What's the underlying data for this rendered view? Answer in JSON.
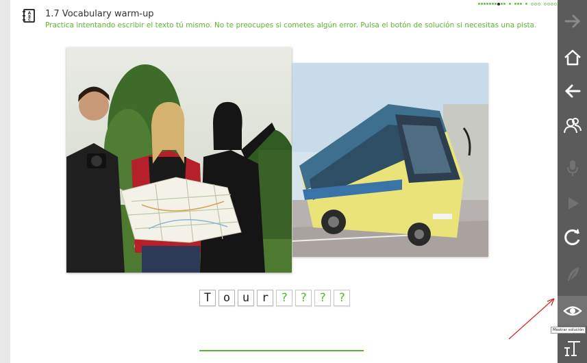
{
  "header": {
    "title": "1.7 Vocabulary warm-up",
    "instructions": "Practica intentando escribir el texto tú mismo. No te preocupes si cometes algún error. Pulsa el botón de solución si necesitas una pista.",
    "icon": "vocabulary-book-icon"
  },
  "progress": {
    "pattern": [
      "done",
      "done",
      "done",
      "done",
      "done",
      "done",
      "done",
      "current",
      "done",
      "done",
      "gap",
      "done",
      "gap",
      "done",
      "done",
      "done",
      "gap",
      "done",
      "gap",
      "todo",
      "todo",
      "todo",
      "gap",
      "todo",
      "todo",
      "todo",
      "todo"
    ]
  },
  "images": [
    {
      "name": "tourists-with-map-photo",
      "subject": "tourists-with-map"
    },
    {
      "name": "coach-bus-photo",
      "subject": "coach-bus"
    }
  ],
  "word": {
    "letters": [
      "T",
      "o",
      "u",
      "r",
      "?",
      "?",
      "?",
      "?"
    ]
  },
  "tooltip": "Mostrar solución",
  "sidebar": {
    "buttons": [
      {
        "name": "next-arrow",
        "enabled": false
      },
      {
        "name": "home",
        "enabled": true
      },
      {
        "name": "back-arrow",
        "enabled": true
      },
      {
        "name": "users",
        "enabled": true
      },
      {
        "name": "microphone",
        "enabled": false
      },
      {
        "name": "play",
        "enabled": false
      },
      {
        "name": "refresh",
        "enabled": true
      },
      {
        "name": "feather",
        "enabled": false
      },
      {
        "name": "eye",
        "enabled": true
      },
      {
        "name": "text",
        "enabled": true
      }
    ]
  },
  "colors": {
    "accent_green": "#5cb82e",
    "sidebar_bg": "#5b5b5b",
    "annotation_arrow": "#d62828"
  }
}
